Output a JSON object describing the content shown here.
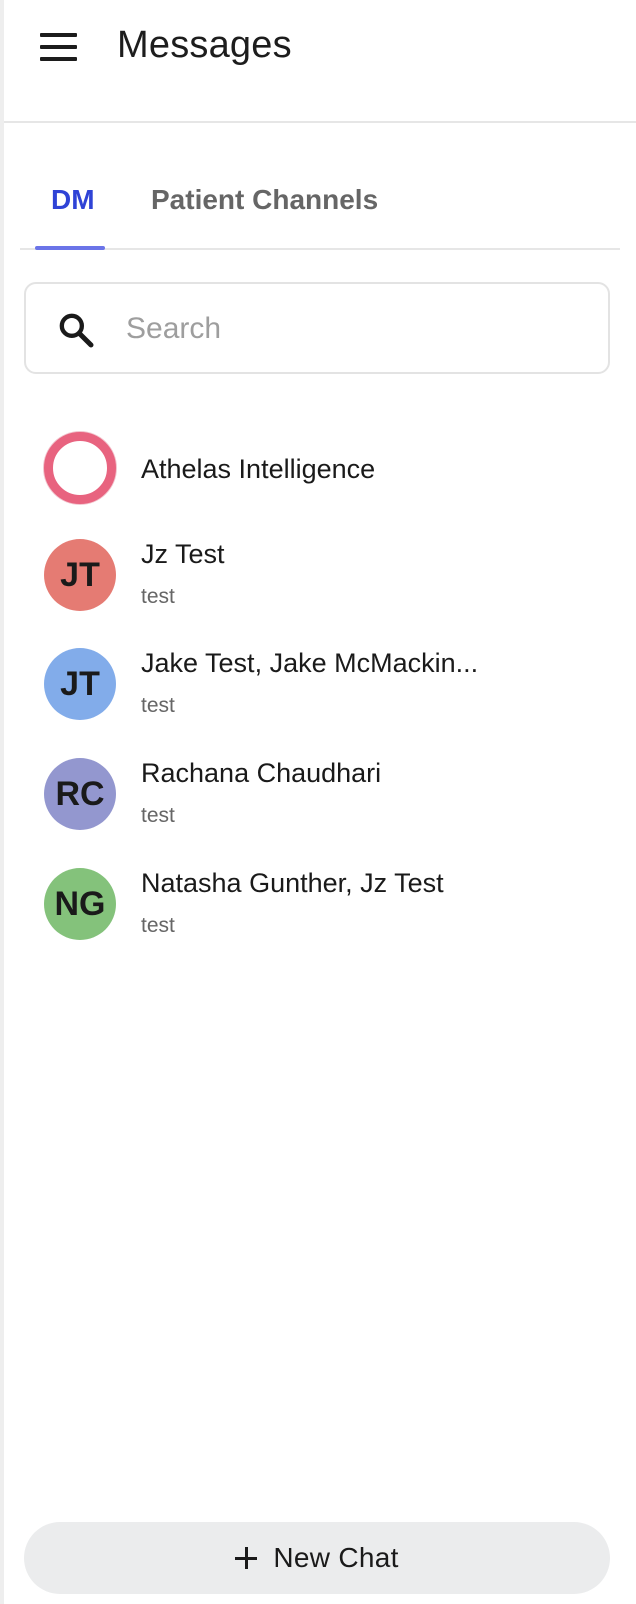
{
  "header": {
    "title": "Messages",
    "menu_icon": "hamburger-menu-icon"
  },
  "tabs": [
    {
      "label": "DM",
      "active": true
    },
    {
      "label": "Patient Channels",
      "active": false
    }
  ],
  "colors": {
    "accent": "#2f43d6",
    "tab_indicator": "#6b74e8"
  },
  "search": {
    "placeholder": "Search",
    "value": "",
    "icon": "search-icon"
  },
  "conversations": [
    {
      "name": "Athelas Intelligence",
      "subtitle": "",
      "initials": "",
      "avatar_color": "#e8637f",
      "avatar_style": "ring"
    },
    {
      "name": "Jz Test",
      "subtitle": "test",
      "initials": "JT",
      "avatar_color": "#e57b73"
    },
    {
      "name": "Jake Test, Jake McMackin...",
      "subtitle": "test",
      "initials": "JT",
      "avatar_color": "#82acea"
    },
    {
      "name": "Rachana Chaudhari",
      "subtitle": "test",
      "initials": "RC",
      "avatar_color": "#9397cf"
    },
    {
      "name": "Natasha Gunther, Jz Test",
      "subtitle": "test",
      "initials": "NG",
      "avatar_color": "#84c27b"
    }
  ],
  "new_chat": {
    "label": "New Chat",
    "icon": "plus-icon"
  }
}
